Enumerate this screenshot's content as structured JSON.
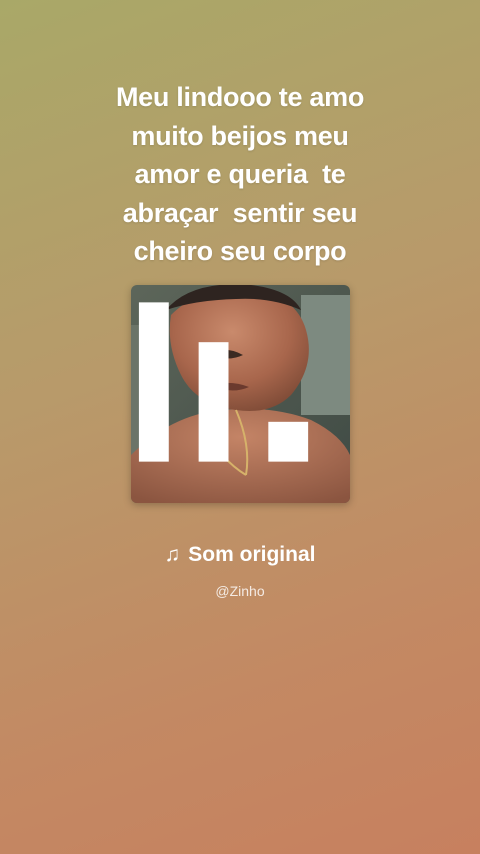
{
  "caption": {
    "lines": [
      "Meu lindooo te amo",
      "muito beijos meu",
      "amor e queria  te",
      "abraçar  sentir seu",
      "cheiro seu corpo"
    ]
  },
  "cover": {
    "badge_icon": "music-app-logo-icon"
  },
  "track": {
    "note_icon": "♫",
    "title": "Som original",
    "artist": "@Zinho"
  },
  "colors": {
    "background_top": "#a9a868",
    "background_bottom": "#c7805f",
    "text": "#ffffff"
  }
}
